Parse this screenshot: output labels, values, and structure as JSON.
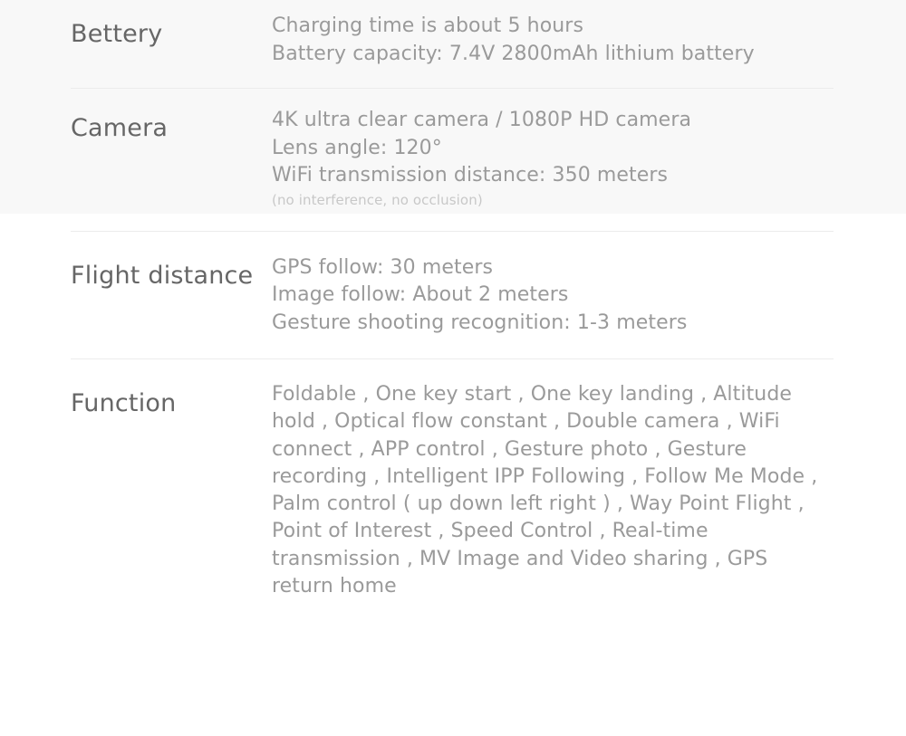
{
  "page": {
    "background_color": "#ffffff",
    "tint_color": "#f8f8f8",
    "label_color": "#666666",
    "value_color": "#9a9a9a",
    "note_color": "#c8c8c8",
    "divider_color": "#ececec"
  },
  "spec_rows": [
    {
      "label": "Bettery",
      "lines": [
        "Charging time is about 5 hours",
        "Battery capacity: 7.4V 2800mAh lithium battery"
      ],
      "note": ""
    },
    {
      "label": "Camera",
      "lines": [
        "4K ultra clear camera / 1080P HD camera",
        "Lens angle: 120°",
        "WiFi transmission distance: 350 meters"
      ],
      "note": "(no interference, no occlusion)"
    },
    {
      "label": "Flight distance",
      "lines": [
        "GPS follow: 30 meters",
        "Image follow: About 2 meters",
        "Gesture shooting recognition: 1-3 meters"
      ],
      "note": ""
    },
    {
      "label": "Function",
      "lines": [
        "Foldable , One key start , One key landing , Altitude hold , Optical flow constant , Double camera , WiFi connect , APP control , Gesture photo , Gesture recording , Intelligent IPP Following , Follow Me Mode , Palm control ( up down left right ) , Way Point Flight , Point of Interest , Speed Control , Real-time transmission , MV Image and Video sharing , GPS return home"
      ],
      "note": ""
    }
  ]
}
